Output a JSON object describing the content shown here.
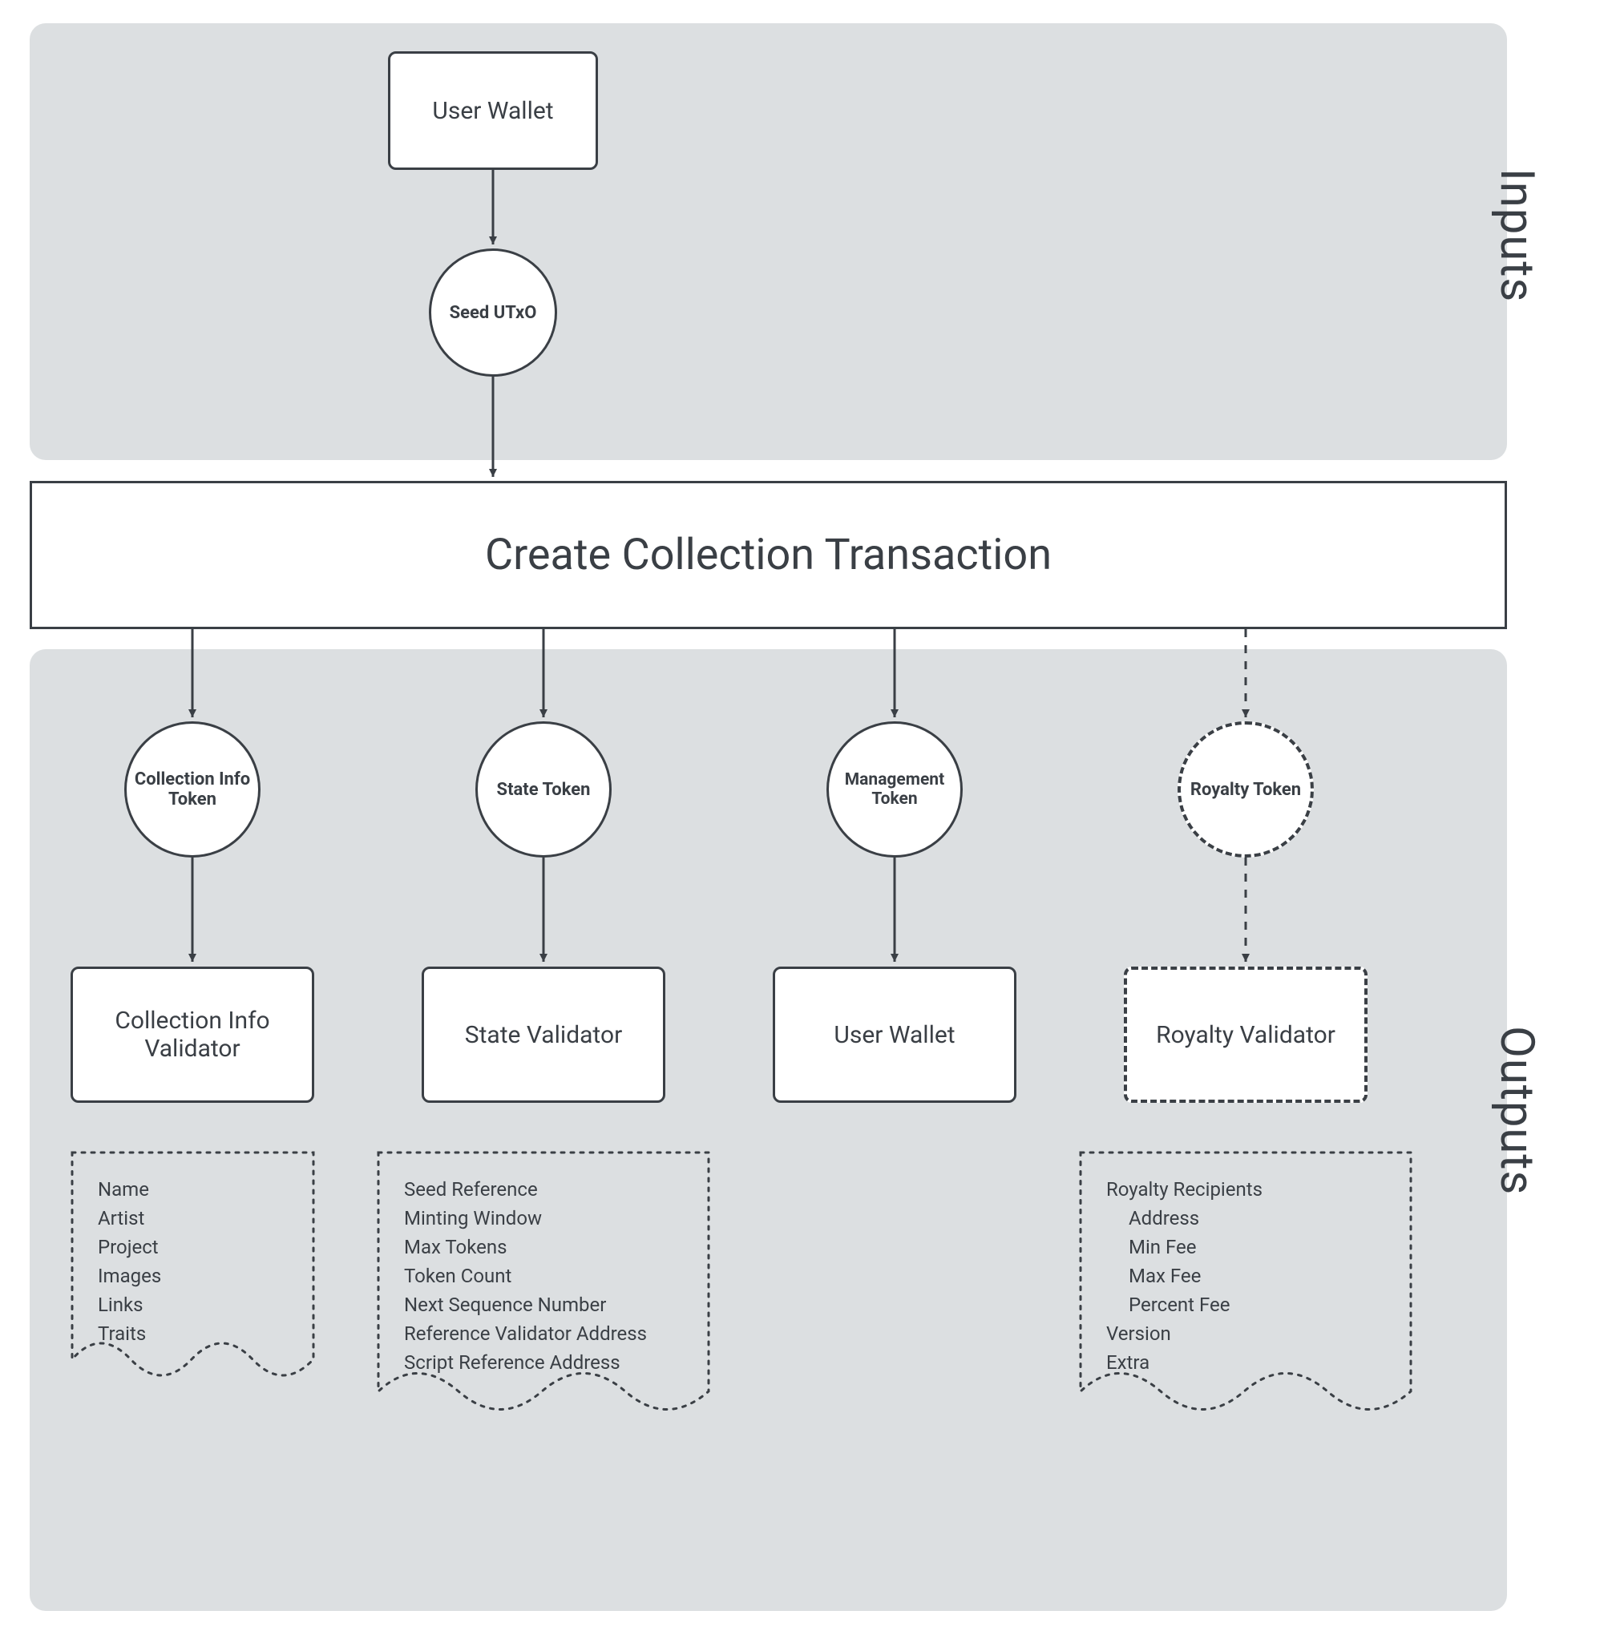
{
  "sections": {
    "inputs": "Inputs",
    "outputs": "Outputs"
  },
  "inputs": {
    "user_wallet": "User Wallet",
    "seed_utxo": "Seed UTxO"
  },
  "main": {
    "title": "Create Collection Transaction"
  },
  "outputs": {
    "col1": {
      "token": "Collection Info Token",
      "validator": "Collection Info Validator",
      "note": [
        "Name",
        "Artist",
        "Project",
        "Images",
        "Links",
        "Traits"
      ]
    },
    "col2": {
      "token": "State Token",
      "validator": "State Validator",
      "note": [
        "Seed Reference",
        "Minting Window",
        "Max Tokens",
        "Token Count",
        "Next Sequence Number",
        "Reference Validator Address",
        "Script Reference Address"
      ]
    },
    "col3": {
      "token": "Management Token",
      "validator": "User Wallet"
    },
    "col4": {
      "token": "Royalty Token",
      "validator": "Royalty Validator",
      "note_main": [
        "Royalty Recipients"
      ],
      "note_sub": [
        "Address",
        "Min Fee",
        "Max Fee",
        "Percent Fee"
      ],
      "note_tail": [
        "Version",
        "Extra"
      ]
    }
  }
}
